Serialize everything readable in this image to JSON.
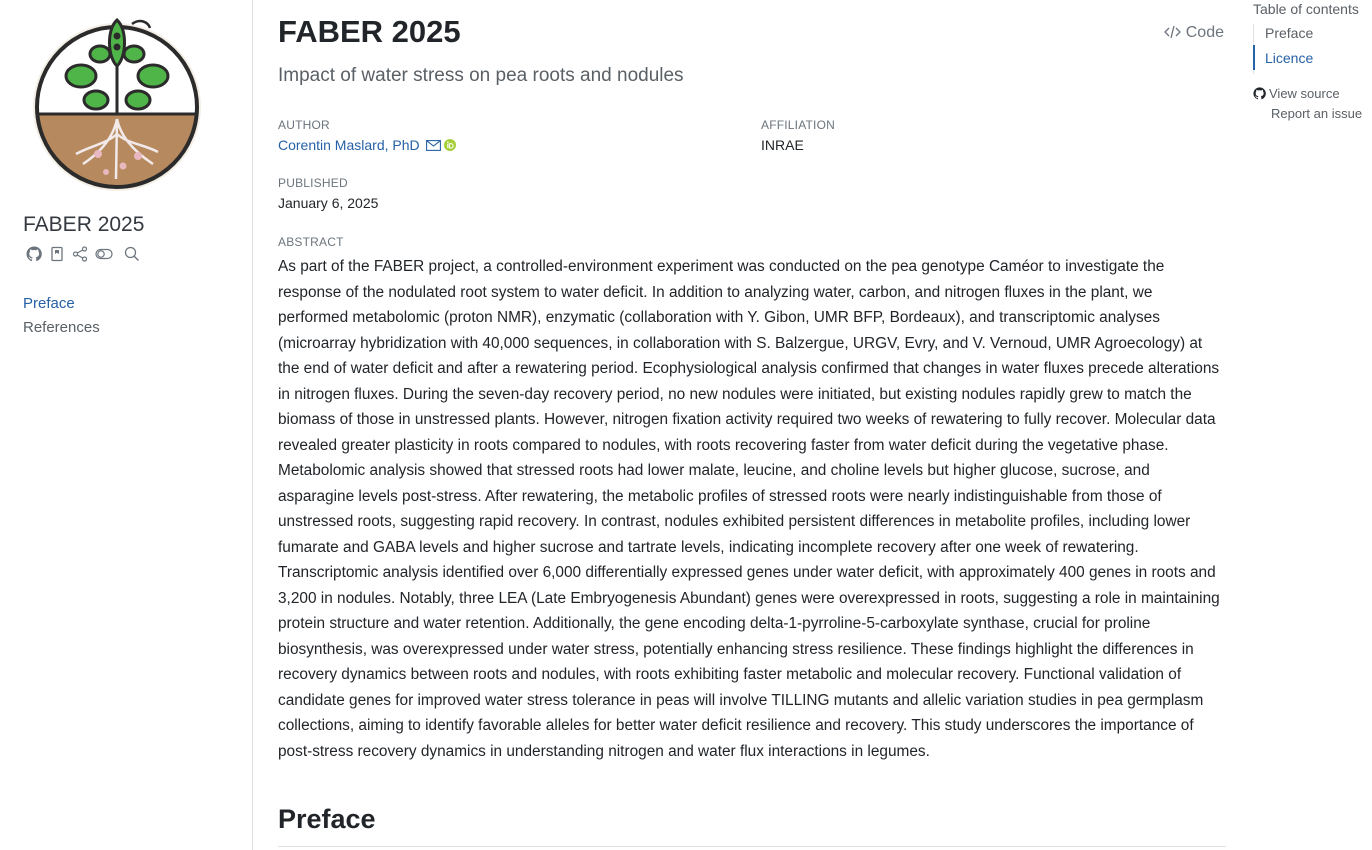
{
  "sidebar": {
    "site_title": "FABER 2025",
    "icons": [
      "github-icon",
      "bookmark-icon",
      "share-icon",
      "toggle-icon",
      "search-icon"
    ],
    "nav": [
      {
        "label": "Preface",
        "active": true
      },
      {
        "label": "References",
        "active": false
      }
    ]
  },
  "header": {
    "title": "FABER 2025",
    "subtitle": "Impact of water stress on pea roots and nodules",
    "code_label": "Code"
  },
  "meta": {
    "author_label": "AUTHOR",
    "author_name": "Corentin Maslard, PhD",
    "affiliation_label": "AFFILIATION",
    "affiliation": "INRAE",
    "published_label": "PUBLISHED",
    "published": "January 6, 2025"
  },
  "abstract": {
    "label": "ABSTRACT",
    "text": "As part of the FABER project, a controlled-environment experiment was conducted on the pea genotype Caméor to investigate the response of the nodulated root system to water deficit. In addition to analyzing water, carbon, and nitrogen fluxes in the plant, we performed metabolomic (proton NMR), enzymatic (collaboration with Y. Gibon, UMR BFP, Bordeaux), and transcriptomic analyses (microarray hybridization with 40,000 sequences, in collaboration with S. Balzergue, URGV, Evry, and V. Vernoud, UMR Agroecology) at the end of water deficit and after a rewatering period. Ecophysiological analysis confirmed that changes in water fluxes precede alterations in nitrogen fluxes. During the seven-day recovery period, no new nodules were initiated, but existing nodules rapidly grew to match the biomass of those in unstressed plants. However, nitrogen fixation activity required two weeks of rewatering to fully recover. Molecular data revealed greater plasticity in roots compared to nodules, with roots recovering faster from water deficit during the vegetative phase. Metabolomic analysis showed that stressed roots had lower malate, leucine, and choline levels but higher glucose, sucrose, and asparagine levels post-stress. After rewatering, the metabolic profiles of stressed roots were nearly indistinguishable from those of unstressed roots, suggesting rapid recovery. In contrast, nodules exhibited persistent differences in metabolite profiles, including lower fumarate and GABA levels and higher sucrose and tartrate levels, indicating incomplete recovery after one week of rewatering. Transcriptomic analysis identified over 6,000 differentially expressed genes under water deficit, with approximately 400 genes in roots and 3,200 in nodules. Notably, three LEA (Late Embryogenesis Abundant) genes were overexpressed in roots, suggesting a role in maintaining protein structure and water retention. Additionally, the gene encoding delta-1-pyrroline-5-carboxylate synthase, crucial for proline biosynthesis, was overexpressed under water stress, potentially enhancing stress resilience. These findings highlight the differences in recovery dynamics between roots and nodules, with roots exhibiting faster metabolic and molecular recovery. Functional validation of candidate genes for improved water stress tolerance in peas will involve TILLING mutants and allelic variation studies in pea germplasm collections, aiming to identify favorable alleles for better water deficit resilience and recovery. This study underscores the importance of post-stress recovery dynamics in understanding nitrogen and water flux interactions in legumes."
  },
  "section": {
    "heading": "Preface"
  },
  "toc": {
    "title": "Table of contents",
    "items": [
      {
        "label": "Preface",
        "current": false
      },
      {
        "label": "Licence",
        "current": true
      }
    ],
    "view_source": "View source",
    "report_issue": "Report an issue"
  },
  "colors": {
    "link": "#2761a6",
    "muted": "#6c757d",
    "orcid": "#a6ce39"
  }
}
